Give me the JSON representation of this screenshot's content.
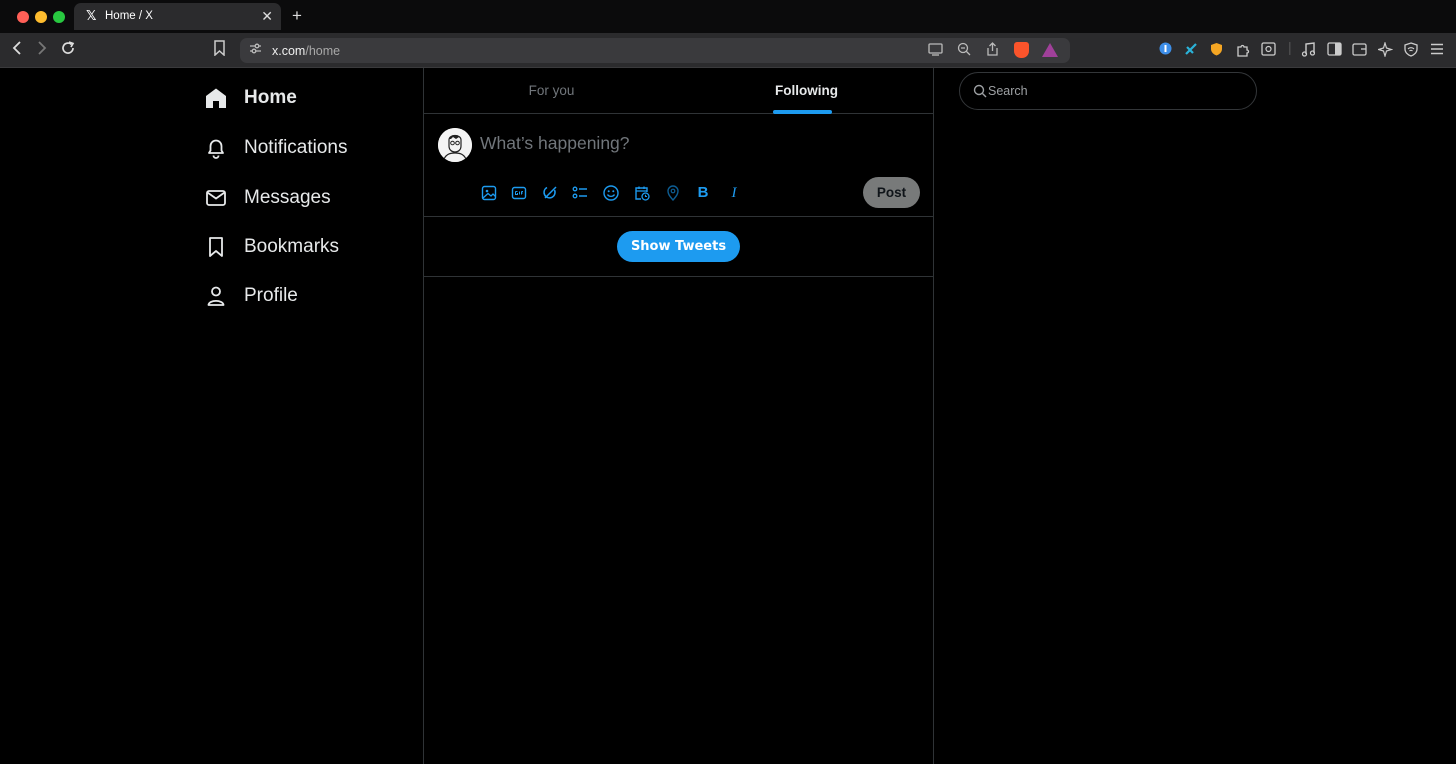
{
  "browser": {
    "tab_title": "Home / X",
    "tab_logo": "𝕏",
    "tab_close": "✕",
    "new_tab": "+",
    "url_host": "x.com",
    "url_path": "/home",
    "icons": [
      "back-icon",
      "forward-icon",
      "reload-icon",
      "bookmark-icon",
      "site-settings-icon",
      "cast-icon",
      "zoom-icon",
      "share-icon",
      "brave-shields-icon",
      "brave-rewards-icon",
      "password-manager-icon",
      "extension-icon",
      "shield-extension-icon",
      "extensions-puzzle-icon",
      "screenshot-icon",
      "media-icon",
      "sidebar-icon",
      "wallet-icon",
      "leo-ai-icon",
      "vpn-icon",
      "menu-icon"
    ]
  },
  "sidebar": {
    "items": [
      {
        "label": "Home",
        "icon": "home-icon",
        "active": true
      },
      {
        "label": "Notifications",
        "icon": "bell-icon"
      },
      {
        "label": "Messages",
        "icon": "envelope-icon"
      },
      {
        "label": "Bookmarks",
        "icon": "bookmark-icon"
      },
      {
        "label": "Profile",
        "icon": "person-icon"
      }
    ]
  },
  "timeline": {
    "tabs": [
      {
        "label": "For you",
        "active": false
      },
      {
        "label": "Following",
        "active": true
      }
    ]
  },
  "composer": {
    "placeholder": "What’s happening?",
    "tools": [
      "image-icon",
      "gif-icon",
      "grok-icon",
      "poll-icon",
      "emoji-icon",
      "schedule-icon",
      "location-icon",
      "bold-icon",
      "italic-icon"
    ],
    "bold_glyph": "B",
    "italic_glyph": "I",
    "post_label": "Post"
  },
  "feed": {
    "show_tweets_label": "Show Tweets"
  },
  "right": {
    "search_placeholder": "Search"
  },
  "colors": {
    "accent": "#1d9bf0",
    "border": "#2f3336",
    "muted": "#71767b"
  }
}
